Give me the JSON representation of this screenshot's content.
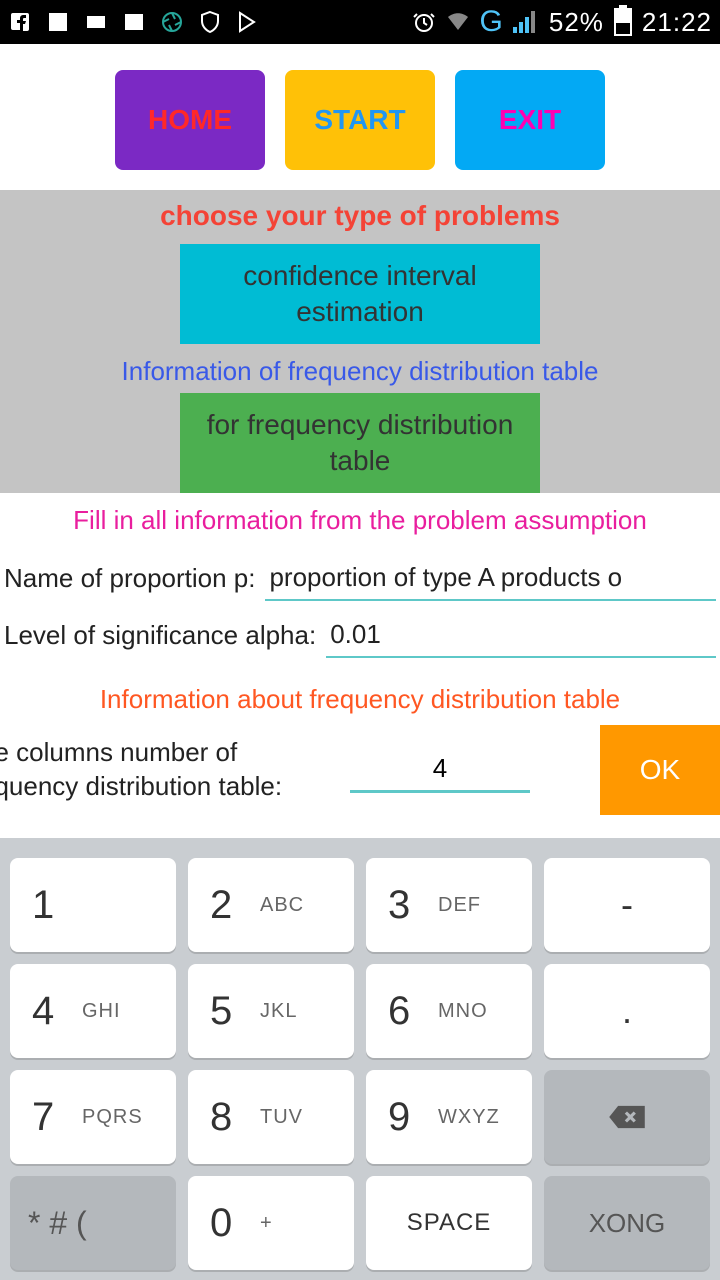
{
  "status": {
    "battery_percent": "52%",
    "time": "21:22",
    "g_label": "G"
  },
  "nav": {
    "home": "HOME",
    "start": "START",
    "exit": "EXIT"
  },
  "problem_section": {
    "heading": "choose your type of problems",
    "confidence_btn": "confidence interval estimation",
    "info_heading": "Information of frequency distribution table",
    "freq_btn": "for frequency distribution table"
  },
  "form": {
    "fill_heading": "Fill in all information from the problem assumption",
    "proportion_label": "Name of proportion p:",
    "proportion_value": "proportion of type A products o",
    "alpha_label": "Level of significance alpha:",
    "alpha_value": "0.01",
    "freq_info_heading": "Information about frequency distribution table",
    "cols_label_line1": "he columns number of",
    "cols_label_line2": "equency distribution table:",
    "cols_value": "4",
    "ok_label": "OK"
  },
  "keypad": {
    "k1": "1",
    "k2": "2",
    "k2s": "ABC",
    "k3": "3",
    "k3s": "DEF",
    "dash": "-",
    "k4": "4",
    "k4s": "GHI",
    "k5": "5",
    "k5s": "JKL",
    "k6": "6",
    "k6s": "MNO",
    "dot": ".",
    "k7": "7",
    "k7s": "PQRS",
    "k8": "8",
    "k8s": "TUV",
    "k9": "9",
    "k9s": "WXYZ",
    "sym": "* # (",
    "k0": "0",
    "k0s": "+",
    "space": "SPACE",
    "done": "XONG"
  }
}
